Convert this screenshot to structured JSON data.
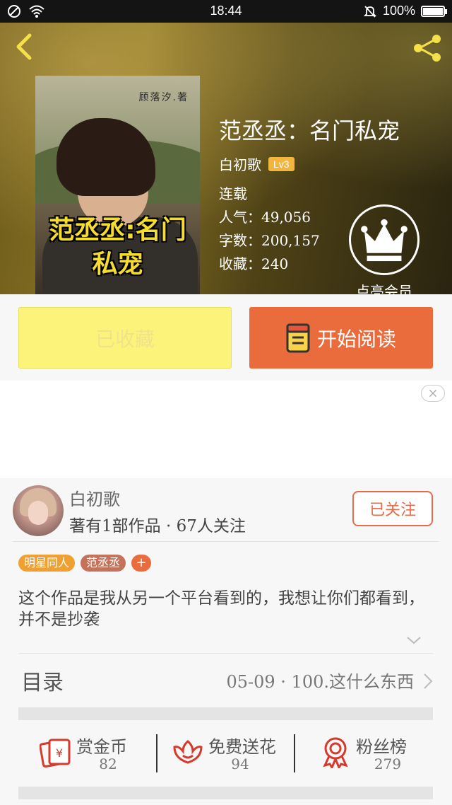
{
  "status_bar": {
    "time": "18:44",
    "battery": "100%",
    "battery_level": 1.0
  },
  "header": {
    "book_title": "范丞丞：名门私宠",
    "author": "白初歌",
    "level": "Lv3",
    "status": "连载",
    "popularity": "人气：49,056",
    "word_count": "字数：200,157",
    "favorites": "收藏：240",
    "vip_label": "点亮会员",
    "cover": {
      "author_text": "顾落汐.著",
      "title_line1": "范丞丞:名门",
      "title_line2": "私宠"
    }
  },
  "actions": {
    "collected_label": "已收藏",
    "read_label": "开始阅读"
  },
  "author_panel": {
    "name": "白初歌",
    "stats": "著有1部作品 · 67人关注",
    "follow_label": "已关注",
    "tags": [
      {
        "label": "明星同人",
        "color": "#f0a030"
      },
      {
        "label": "范丞丞",
        "color": "#c4735a"
      }
    ],
    "tag_add": "+",
    "description": "这个作品是我从另一个平台看到的，我想让你们都看到，并不是抄袭"
  },
  "toc": {
    "label": "目录",
    "latest": "05-09 · 100.这什么东西"
  },
  "stats": [
    {
      "label": "赏金币",
      "count": "82",
      "icon": "reward-coin-icon"
    },
    {
      "label": "免费送花",
      "count": "94",
      "icon": "flower-icon"
    },
    {
      "label": "粉丝榜",
      "count": "279",
      "icon": "fan-rank-icon"
    }
  ],
  "colors": {
    "accent": "#ea6b3c",
    "collected_bg": "#fcf47a",
    "level_badge": "#f0b640"
  }
}
